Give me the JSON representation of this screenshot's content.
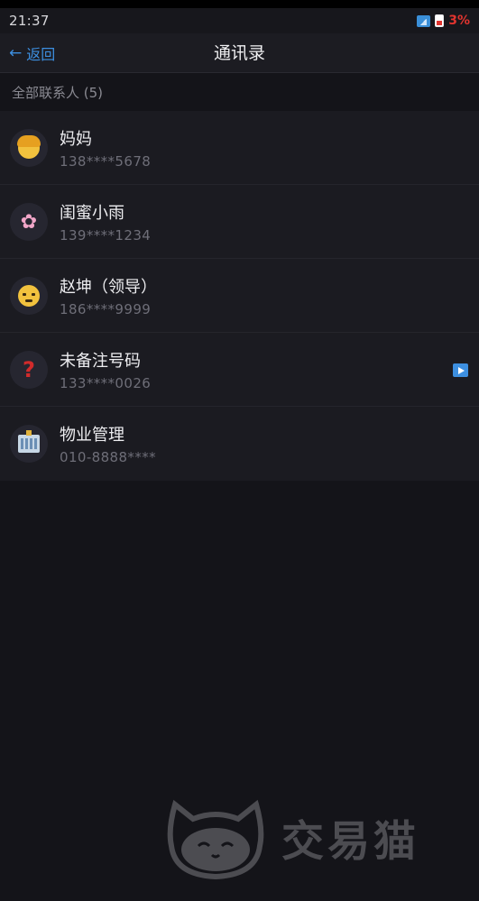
{
  "status_bar": {
    "time": "21:37",
    "battery": "3%",
    "battery_color": "#e0342f",
    "signal_color": "#3a8fd8"
  },
  "nav": {
    "back_label": "返回",
    "back_icon": "arrow-left-icon",
    "title": "通讯录",
    "accent_color": "#3d8fe0"
  },
  "section": {
    "header": "全部联系人 (5)"
  },
  "contacts": [
    {
      "name": "妈妈",
      "phone": "138****5678",
      "avatar": "woman-face-icon"
    },
    {
      "name": "闺蜜小雨",
      "phone": "139****1234",
      "avatar": "cherry-blossom-icon"
    },
    {
      "name": "赵坤（领导）",
      "phone": "186****9999",
      "avatar": "angry-face-icon"
    },
    {
      "name": "未备注号码",
      "phone": "133****0026",
      "avatar": "question-mark-icon",
      "action_icon": "play-icon"
    },
    {
      "name": "物业管理",
      "phone": "010-8888****",
      "avatar": "building-icon"
    }
  ],
  "watermark": {
    "text": "交易猫",
    "logo": "cat-logo-icon"
  }
}
